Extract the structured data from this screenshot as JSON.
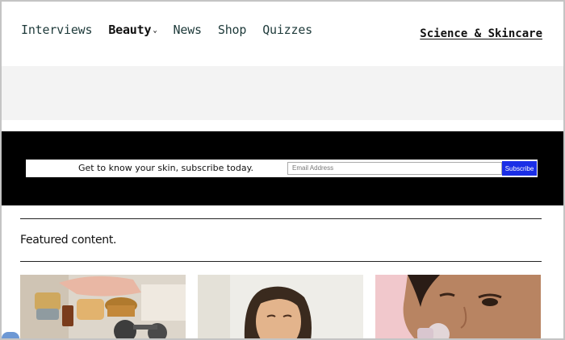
{
  "nav": {
    "items": [
      {
        "label": "Interviews",
        "active": false
      },
      {
        "label": "Beauty",
        "active": true,
        "has_dropdown": true
      },
      {
        "label": "News",
        "active": false
      },
      {
        "label": "Shop",
        "active": false
      },
      {
        "label": "Quizzes",
        "active": false
      }
    ],
    "right_link": "Science & Skincare"
  },
  "subscribe": {
    "text": "Get to know your skin, subscribe today.",
    "email_placeholder": "Email Address",
    "button_label": "Subscribe",
    "button_color": "#1a2ee6"
  },
  "featured": {
    "title": "Featured content."
  },
  "colors": {
    "subscribe_bg": "#000000",
    "grey_band": "#f3f3f3",
    "nav_text": "#1e3a3a"
  }
}
